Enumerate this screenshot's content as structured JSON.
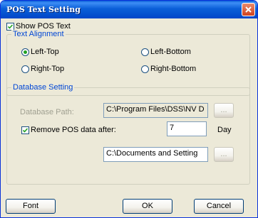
{
  "window": {
    "title": "POS Text Setting"
  },
  "show_pos_text": {
    "label": "Show POS Text",
    "checked": true
  },
  "text_alignment": {
    "group_label": "Text Alignment",
    "options": [
      "Left-Top",
      "Left-Bottom",
      "Right-Top",
      "Right-Bottom"
    ],
    "selected": "Left-Top"
  },
  "database_setting": {
    "group_label": "Database Setting",
    "path_label": "Database Path:",
    "path_value": "C:\\Program Files\\DSS\\NV D",
    "browse_label": "...",
    "remove_label": "Remove POS data after:",
    "remove_checked": true,
    "days_value": "7",
    "days_unit": "Day",
    "second_path_value": "C:\\Documents and Setting",
    "second_browse_label": "..."
  },
  "buttons": {
    "font": "Font",
    "ok": "OK",
    "cancel": "Cancel"
  },
  "colors": {
    "title_bar": "#0a5fd8",
    "close_button": "#d0421f",
    "dialog_background": "#ece9d8",
    "group_label": "#0046d5",
    "check_mark": "#21a121"
  }
}
